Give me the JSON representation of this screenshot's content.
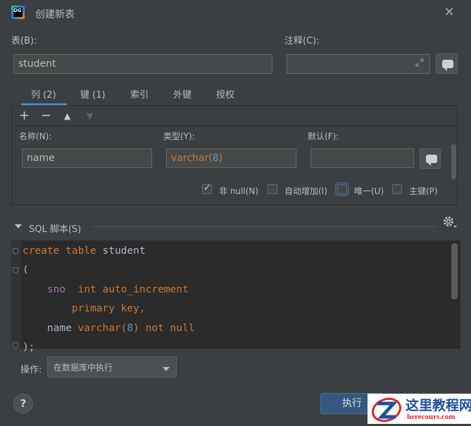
{
  "window": {
    "title": "创建新表",
    "app_icon_text": "DG"
  },
  "table_field": {
    "label": "表(B):",
    "value": "student"
  },
  "comment_field": {
    "label": "注释(C):",
    "value": ""
  },
  "tabs": [
    {
      "label": "列 (2)",
      "active": true
    },
    {
      "label": "键 (1)",
      "active": false
    },
    {
      "label": "索引",
      "active": false
    },
    {
      "label": "外键",
      "active": false
    },
    {
      "label": "授权",
      "active": false
    }
  ],
  "toolbar": {
    "add": "+",
    "remove": "−",
    "up": "▲",
    "down": "▼"
  },
  "column": {
    "name_label": "名称(N):",
    "name_value": "name",
    "type_label": "类型(Y):",
    "type_value_prefix": "varchar(",
    "type_value_num": "8",
    "type_value_suffix": ")",
    "default_label": "默认(F):",
    "default_value": ""
  },
  "checkboxes": [
    {
      "label": "非 null(N)",
      "checked": true
    },
    {
      "label": "自动增加(I)",
      "checked": false
    },
    {
      "label": "唯一(U)",
      "checked": false,
      "focused": true
    },
    {
      "label": "主键(P)",
      "checked": false
    }
  ],
  "sql_section": {
    "label": "SQL 脚本(S)"
  },
  "sql_lines": {
    "l1_kw": "create table",
    "l1_id": " student",
    "l2": "(",
    "l3_col": "sno",
    "l3_kw": "  int auto_increment",
    "l4_kw": "primary key,",
    "l5_id": "name ",
    "l5_kw1": "varchar(",
    "l5_num": "8",
    "l5_kw2": ")",
    "l5_kw3": " not null",
    "l6": ");"
  },
  "operation": {
    "label": "操作:",
    "selected": "在数据库中执行"
  },
  "buttons": {
    "run": "执行",
    "help": "?"
  },
  "watermark": {
    "title": "这里教程网",
    "url": "herecours.com"
  }
}
